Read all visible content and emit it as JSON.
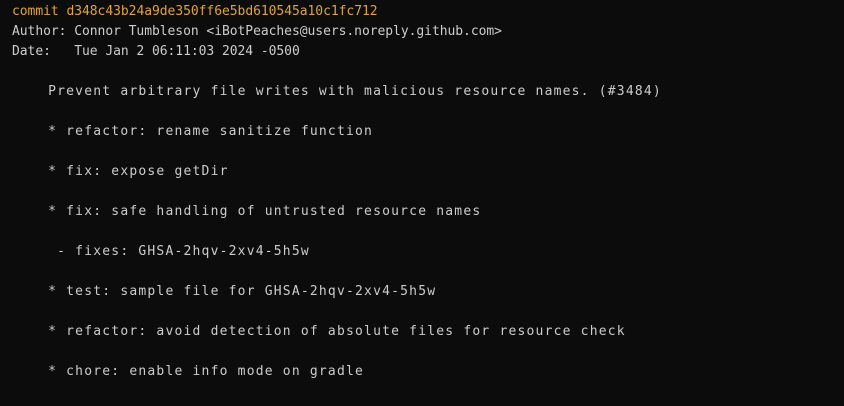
{
  "commit": {
    "label": "commit",
    "hash": "d348c43b24a9de350ff6e5bd610545a10c1fc712",
    "author_line": "Author: Connor Tumbleson <iBotPeaches@users.noreply.github.com>",
    "date_line": "Date:   Tue Jan 2 06:11:03 2024 -0500"
  },
  "message": [
    "    Prevent arbitrary file writes with malicious resource names. (#3484)",
    "    * refactor: rename sanitize function",
    "    * fix: expose getDir",
    "    * fix: safe handling of untrusted resource names",
    "     - fixes: GHSA-2hqv-2xv4-5h5w",
    "    * test: sample file for GHSA-2hqv-2xv4-5h5w",
    "    * refactor: avoid detection of absolute files for resource check",
    "    * chore: enable info mode on gradle"
  ],
  "colors": {
    "background": "#0c0c0c",
    "text": "#cccccc",
    "commit": "#e0a437"
  }
}
